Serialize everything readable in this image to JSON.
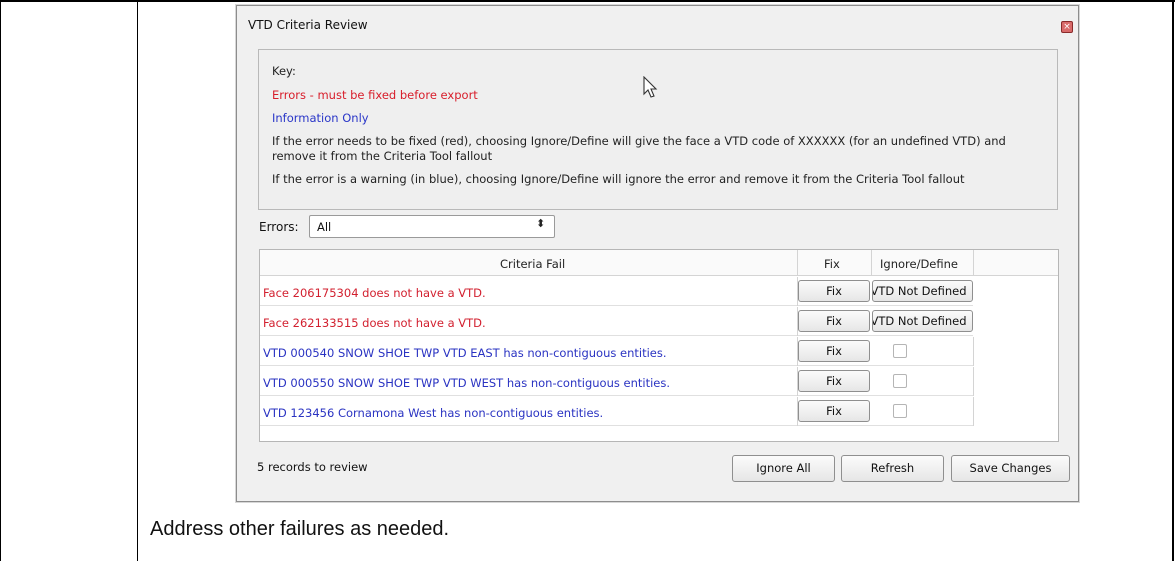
{
  "dialog": {
    "title": "VTD Criteria Review",
    "close_icon": "close-icon"
  },
  "key": {
    "heading": "Key:",
    "errors_line": "Errors - must be fixed before export",
    "info_line": "Information Only",
    "red_note_line1": "If the error needs to be fixed (red), choosing Ignore/Define will give the face a VTD code of XXXXXX (for an undefined VTD) and",
    "red_note_line2": "remove it from the Criteria Tool fallout",
    "blue_note": "If the error is a warning (in blue), choosing Ignore/Define will ignore the error and remove it from the Criteria Tool fallout",
    "error_color": "#d81d2a",
    "info_color": "#2a36c8"
  },
  "filter": {
    "label": "Errors:",
    "selected": "All"
  },
  "grid": {
    "columns": [
      "Criteria Fail",
      "Fix",
      "Ignore/Define"
    ],
    "rows": [
      {
        "text": "Face 206175304 does not have a VTD.",
        "severity": "error",
        "fix": "Fix",
        "ignore": "VTD Not Defined"
      },
      {
        "text": "Face 262133515 does not have a VTD.",
        "severity": "error",
        "fix": "Fix",
        "ignore": "VTD Not Defined"
      },
      {
        "text": "VTD 000540 SNOW SHOE TWP VTD EAST has non-contiguous entities.",
        "severity": "info",
        "fix": "Fix",
        "ignore": ""
      },
      {
        "text": "VTD 000550 SNOW SHOE TWP VTD WEST has non-contiguous entities.",
        "severity": "info",
        "fix": "Fix",
        "ignore": ""
      },
      {
        "text": "VTD 123456 Cornamona West has non-contiguous entities.",
        "severity": "info",
        "fix": "Fix",
        "ignore": ""
      }
    ]
  },
  "footer": {
    "records": "5 records to review",
    "ignore_all": "Ignore All",
    "refresh": "Refresh",
    "save": "Save Changes"
  },
  "document": {
    "caption": "Address other failures as needed."
  }
}
